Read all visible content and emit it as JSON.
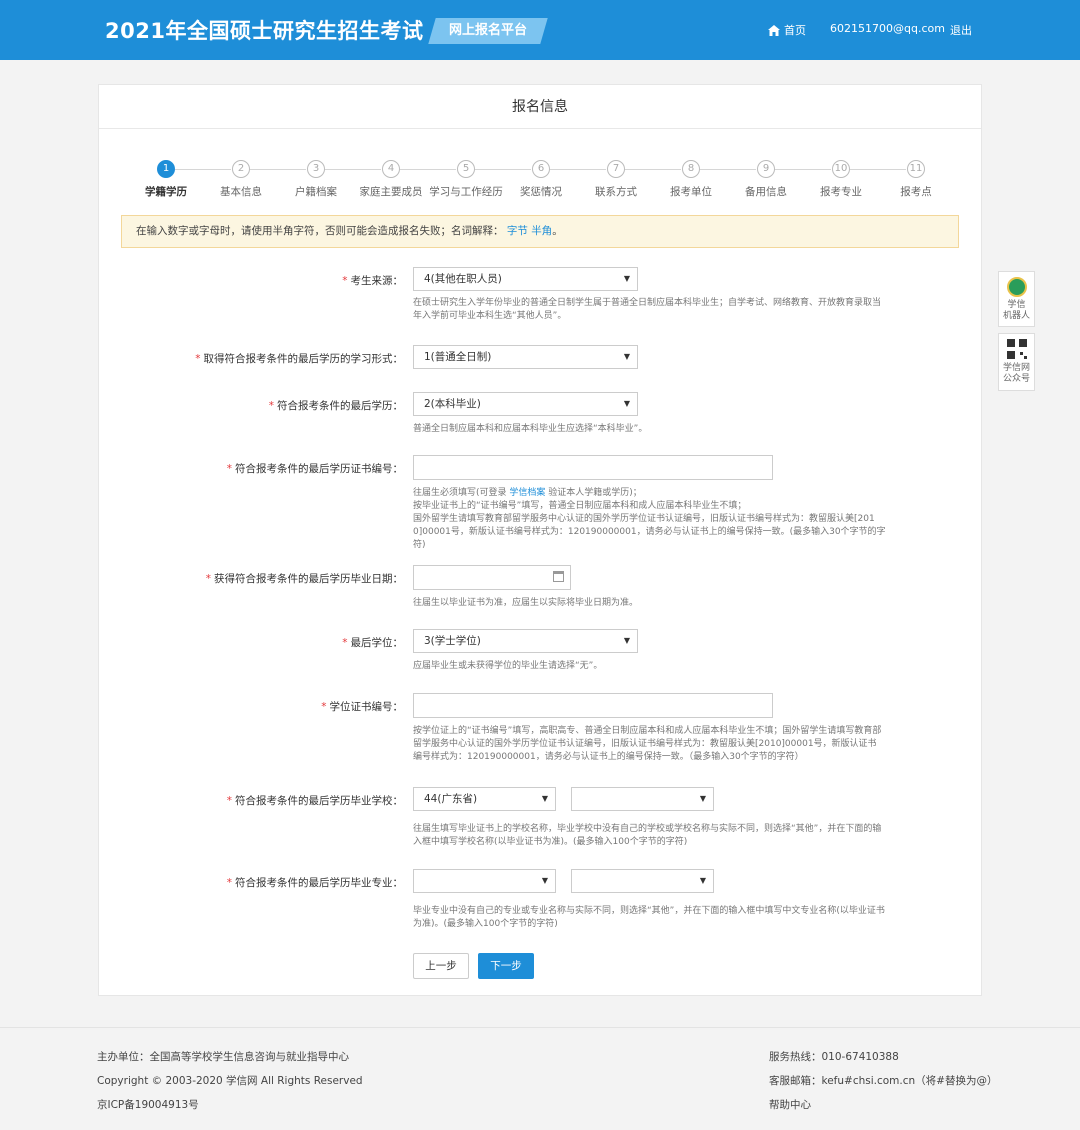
{
  "header": {
    "title": "2021年全国硕士研究生招生考试",
    "platform": "网上报名平台",
    "home": "首页",
    "email": "602151700@qq.com",
    "logout": "退出"
  },
  "card": {
    "title": "报名信息"
  },
  "steps": [
    {
      "num": "1",
      "label": "学籍学历"
    },
    {
      "num": "2",
      "label": "基本信息"
    },
    {
      "num": "3",
      "label": "户籍档案"
    },
    {
      "num": "4",
      "label": "家庭主要成员"
    },
    {
      "num": "5",
      "label": "学习与工作经历"
    },
    {
      "num": "6",
      "label": "奖惩情况"
    },
    {
      "num": "7",
      "label": "联系方式"
    },
    {
      "num": "8",
      "label": "报考单位"
    },
    {
      "num": "9",
      "label": "备用信息"
    },
    {
      "num": "10",
      "label": "报考专业"
    },
    {
      "num": "11",
      "label": "报考点"
    }
  ],
  "notice": {
    "text": "在输入数字或字母时，请使用半角字符，否则可能会造成报名失败；名词解释：",
    "link1": "字节",
    "link2": "半角",
    "end": "。"
  },
  "form": {
    "source": {
      "label": "考生来源：",
      "value": "4(其他在职人员)",
      "help1": "在硕士研究生入学年份毕业的普通全日制学生属于普通全日制应届本科毕业生；自学考试、网络教育、开放教育录取当",
      "help2": "年入学前可毕业本科生选“其他人员”。"
    },
    "study_form": {
      "label": "取得符合报考条件的最后学历的学习形式：",
      "value": "1(普通全日制)"
    },
    "last_degree_edu": {
      "label": "符合报考条件的最后学历：",
      "value": "2(本科毕业)",
      "help1": "普通全日制应届本科和应届本科毕业生应选择“本科毕业”。"
    },
    "cert_no": {
      "label": "符合报考条件的最后学历证书编号：",
      "help_a": "往届生必须填写(可登录 ",
      "help_link": "学信档案",
      "help_b": " 验证本人学籍或学历)；",
      "help2": "按毕业证书上的“证书编号”填写，普通全日制应届本科和成人应届本科毕业生不填；",
      "help3": "国外留学生请填写教育部留学服务中心认证的国外学历学位证书认证编号，旧版认证书编号样式为：教留服认美[201",
      "help4": "0]00001号，新版认证书编号样式为：120190000001，请务必与认证书上的编号保持一致。(最多输入30个字节的字符)"
    },
    "grad_date": {
      "label": "获得符合报考条件的最后学历毕业日期：",
      "help1": "往届生以毕业证书为准，应届生以实际将毕业日期为准。"
    },
    "last_degree": {
      "label": "最后学位：",
      "value": "3(学士学位)",
      "help1": "应届毕业生或未获得学位的毕业生请选择“无”。"
    },
    "degree_cert": {
      "label": "学位证书编号：",
      "help1": "按学位证上的“证书编号”填写，高职高专、普通全日制应届本科和成人应届本科毕业生不填；国外留学生请填写教育部",
      "help2": "留学服务中心认证的国外学历学位证书认证编号，旧版认证书编号样式为：教留服认美[2010]00001号，新版认证书",
      "help3": "编号样式为：120190000001，请务必与认证书上的编号保持一致。（最多输入30个字节的字符）"
    },
    "school": {
      "label": "符合报考条件的最后学历毕业学校：",
      "province": "44(广东省)",
      "help1": "往届生填写毕业证书上的学校名称，毕业学校中没有自己的学校或学校名称与实际不同，则选择“其他”，并在下面的输",
      "help2": "入框中填写学校名称(以毕业证书为准)。(最多输入100个字节的字符)"
    },
    "major": {
      "label": "符合报考条件的最后学历毕业专业：",
      "help1": "毕业专业中没有自己的专业或专业名称与实际不同，则选择“其他”，并在下面的输入框中填写中文专业名称(以毕业证书",
      "help2": "为准)。(最多输入100个字节的字符)"
    },
    "required_mark": "*"
  },
  "buttons": {
    "prev": "上一步",
    "next": "下一步"
  },
  "side": {
    "robot_line1": "学信",
    "robot_line2": "机器人",
    "qr_line1": "学信网",
    "qr_line2": "公众号"
  },
  "footer": {
    "organizer": "主办单位：全国高等学校学生信息咨询与就业指导中心",
    "copyright": "Copyright © 2003-2020 学信网 All Rights Reserved",
    "icp": "京ICP备19004913号",
    "hotline": "服务热线：010-67410388",
    "email": "客服邮箱：kefu#chsi.com.cn（将#替换为@）",
    "help": "帮助中心"
  },
  "colors": {
    "brand": "#1e8ed8",
    "required": "#e4393c",
    "notice_bg": "#fcf6e1"
  }
}
